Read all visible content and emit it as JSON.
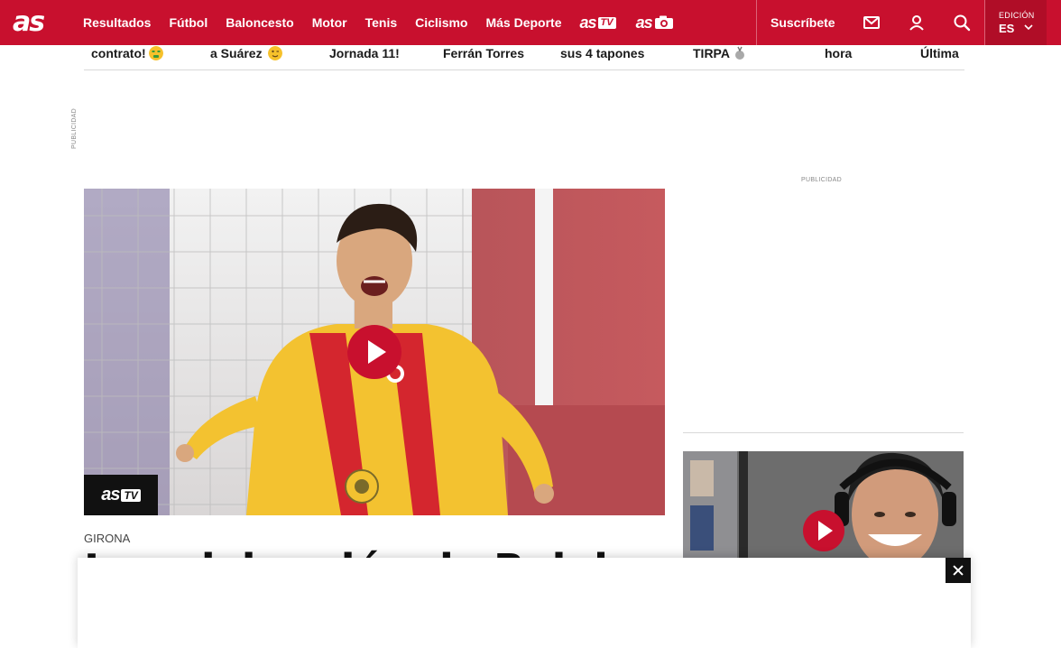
{
  "header": {
    "logo": "as",
    "nav": [
      "Resultados",
      "Fútbol",
      "Baloncesto",
      "Motor",
      "Tenis",
      "Ciclismo",
      "Más Deporte"
    ],
    "brand_tv": {
      "text": "as",
      "badge": "TV"
    },
    "brand_photo": {
      "text": "as"
    },
    "subscribe_label": "Suscríbete",
    "icons": {
      "mail": "mail-icon",
      "user": "user-icon",
      "search": "search-icon",
      "chevron": "chevron-down-icon"
    },
    "edition_label": "EDICIÓN",
    "edition_value": "ES"
  },
  "trending": [
    {
      "text": "contrato!",
      "emoji": "money-mouth-face"
    },
    {
      "text": "a Suárez",
      "emoji": "winking-face"
    },
    {
      "text": "Jornada 11!"
    },
    {
      "text": "Ferrán Torres"
    },
    {
      "text": "sus 4 tapones"
    },
    {
      "text": "TIRPA",
      "emoji": "medal"
    },
    {
      "text": "hora"
    },
    {
      "text": "Última"
    }
  ],
  "ads": {
    "label_vertical": "PUBLICIDAD",
    "label_side": "PUBLICIDAD"
  },
  "main_video": {
    "badge_text": "as",
    "badge_tv": "TV",
    "section": "GIRONA",
    "headline": "La celebración de Reinier"
  },
  "colors": {
    "brand_red": "#c8102e",
    "text": "#1a1a1a",
    "rule": "#d9d9d9"
  }
}
